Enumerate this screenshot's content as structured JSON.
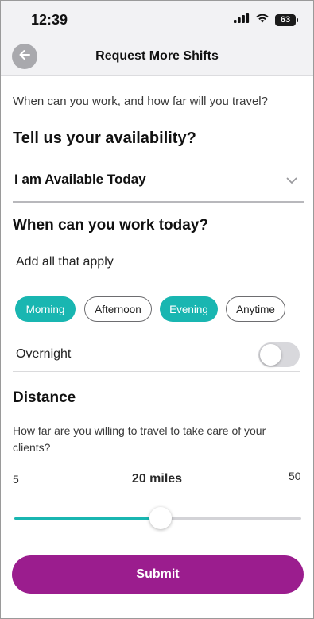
{
  "status_bar": {
    "time": "12:39",
    "battery": "63"
  },
  "header": {
    "title": "Request More Shifts"
  },
  "intro": "When can you work, and how far will you travel?",
  "availability": {
    "heading": "Tell us your availability?",
    "selected": "I am Available Today"
  },
  "work_times": {
    "heading": "When can you work today?",
    "subheading": "Add all that apply",
    "chips": [
      {
        "label": "Morning",
        "selected": true
      },
      {
        "label": "Afternoon",
        "selected": false
      },
      {
        "label": "Evening",
        "selected": true
      },
      {
        "label": "Anytime",
        "selected": false
      }
    ],
    "overnight": {
      "label": "Overnight",
      "on": false
    }
  },
  "distance": {
    "heading": "Distance",
    "description": "How far are you willing to travel to take care of your clients?",
    "min_label": "5",
    "max_label": "50",
    "current_label": "20 miles",
    "min": 5,
    "max": 50,
    "value": 20
  },
  "submit_label": "Submit",
  "colors": {
    "accent": "#19b6b1",
    "primary": "#9b1d8e"
  },
  "icons": [
    "cellular-signal-icon",
    "wifi-icon",
    "battery-icon",
    "back-arrow-icon",
    "chevron-down-icon"
  ]
}
